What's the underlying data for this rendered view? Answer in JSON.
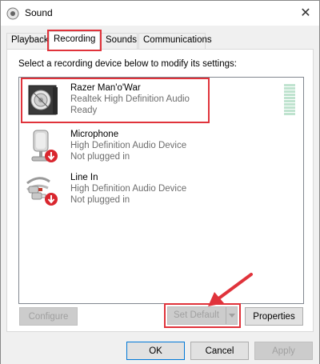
{
  "window": {
    "title": "Sound",
    "close_glyph": "✕"
  },
  "tabs": [
    {
      "label": "Playback"
    },
    {
      "label": "Recording"
    },
    {
      "label": "Sounds"
    },
    {
      "label": "Communications"
    }
  ],
  "panel": {
    "instruction": "Select a recording device below to modify its settings:"
  },
  "devices": [
    {
      "name": "Razer Man'o'War",
      "description": "Realtek High Definition Audio",
      "status": "Ready",
      "icon": "speaker-headset-icon"
    },
    {
      "name": "Microphone",
      "description": "High Definition Audio Device",
      "status": "Not plugged in",
      "icon": "microphone-icon"
    },
    {
      "name": "Line In",
      "description": "High Definition Audio Device",
      "status": "Not plugged in",
      "icon": "line-in-jack-icon"
    }
  ],
  "buttons": {
    "configure": "Configure",
    "set_default": "Set Default",
    "properties": "Properties",
    "ok": "OK",
    "cancel": "Cancel",
    "apply": "Apply"
  },
  "colors": {
    "highlight": "#e0333b",
    "status_red": "#d9262e",
    "meter_green": "#bfe3cf"
  }
}
